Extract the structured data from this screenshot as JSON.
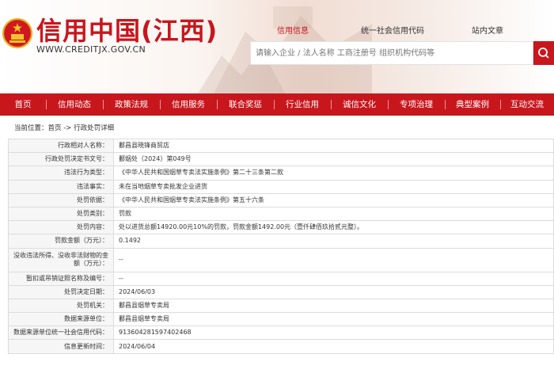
{
  "header": {
    "site_title": "信用中国(江西)",
    "site_url": "WWW.CREDITJX.GOV.CN",
    "top_links": [
      {
        "label": "信用信息",
        "active": true
      },
      {
        "label": "统一社会信用代码",
        "active": false
      },
      {
        "label": "站内文章",
        "active": false
      }
    ],
    "search_placeholder": "请输入企业 / 法人名称 工商注册号 组织机构代码等"
  },
  "nav": {
    "items": [
      "首页",
      "信用动态",
      "政策法规",
      "信用服务",
      "联合奖惩",
      "行业信用",
      "诚信文化",
      "专项治理",
      "典型案例",
      "互动交流"
    ]
  },
  "breadcrumb": "当前位置：首页 -> 行政处罚详细",
  "details": [
    {
      "key": "行政相对人名称：",
      "value": "鄱昌县晓锋商贸店"
    },
    {
      "key": "行政处罚决定书文号：",
      "value": "鄱烟处（2024）第049号"
    },
    {
      "key": "违法行为类型：",
      "value": "《中华人民共和国烟草专卖法实施条例》第二十三条第二款"
    },
    {
      "key": "违法事实：",
      "value": "未在当地烟草专卖批发企业进货"
    },
    {
      "key": "处罚依据：",
      "value": "《中华人民共和国烟草专卖法实施条例》第五十六条"
    },
    {
      "key": "处罚类别：",
      "value": "罚款"
    },
    {
      "key": "处罚内容：",
      "value": "处以进货总额14920.00元10%的罚款，罚款金额1492.00元（壹仟肆佰玖拾贰元整）。"
    },
    {
      "key": "罚款金额（万元）：",
      "value": "0.1492"
    },
    {
      "key": "没收违法所得、没收非法财物的金额（万元）：",
      "value": "--",
      "tall": true
    },
    {
      "key": "暂扣或吊销证照名称及编号：",
      "value": "--"
    },
    {
      "key": "处罚决定日期：",
      "value": "2024/06/03"
    },
    {
      "key": "处罚机关：",
      "value": "鄱昌县烟草专卖局"
    },
    {
      "key": "数据来源单位：",
      "value": "鄱昌县烟草专卖局"
    },
    {
      "key": "数据来源单位统一社会信用代码：",
      "value": "913604281597402468"
    },
    {
      "key": "信息更新时间：",
      "value": "2024/06/04"
    }
  ],
  "colors": {
    "brand_red": "#c8161d",
    "label_bg": "#f6f6f6",
    "border": "#dcdcdc"
  },
  "icons": {
    "emblem": "national-emblem-icon",
    "search": "search-icon"
  }
}
